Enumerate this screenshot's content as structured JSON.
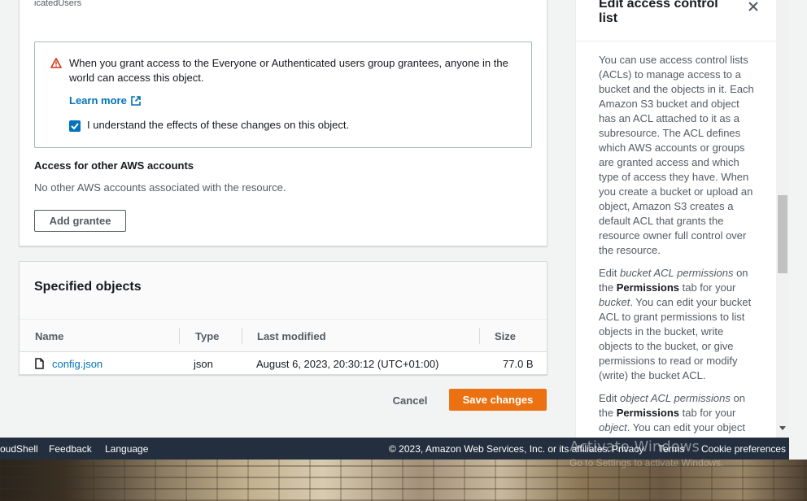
{
  "main": {
    "clipped_text": "icatedUsers",
    "warning": {
      "text": "When you grant access to the Everyone or Authenticated users group grantees, anyone in the world can access this object.",
      "learn_more": "Learn more",
      "checkbox_label": "I understand the effects of these changes on this object.",
      "checkbox_checked": true
    },
    "other_accounts": {
      "heading": "Access for other AWS accounts",
      "description": "No other AWS accounts associated with the resource.",
      "add_grantee": "Add grantee"
    },
    "specified_objects": {
      "title": "Specified objects",
      "columns": [
        "Name",
        "Type",
        "Last modified",
        "Size"
      ],
      "rows": [
        {
          "name": "config.json",
          "type": "json",
          "last_modified": "August 6, 2023, 20:30:12 (UTC+01:00)",
          "size": "77.0 B"
        }
      ]
    },
    "actions": {
      "cancel": "Cancel",
      "save": "Save changes"
    }
  },
  "help_panel": {
    "title": "Edit access control list",
    "p1": "You can use access control lists (ACLs) to manage access to a bucket and the objects in it. Each Amazon S3 bucket and object has an ACL attached to it as a subresource. The ACL defines which AWS accounts or groups are granted access and which type of access they have. When you create a bucket or upload an object, Amazon S3 creates a default ACL that grants the resource owner full control over the resource.",
    "p2_a": "Edit ",
    "p2_em": "bucket ACL permissions",
    "p2_b": " on the ",
    "p2_strong": "Permissions",
    "p2_c": " tab for your ",
    "p2_em2": "bucket",
    "p2_d": ". You can edit your bucket ACL to grant permissions to list objects in the bucket, write objects to the bucket, or give permissions to read or modify (write) the bucket ACL.",
    "p3_a": "Edit ",
    "p3_em": "object ACL permissions",
    "p3_b": " on the ",
    "p3_strong": "Permissions",
    "p3_c": " tab for your ",
    "p3_em2": "object",
    "p3_d": ". You can edit your object ACL to grant..."
  },
  "footer": {
    "cloudshell": "oudShell",
    "feedback": "Feedback",
    "language": "Language",
    "copyright": "© 2023, Amazon Web Services, Inc. or its affiliates.",
    "privacy": "Privacy",
    "terms": "Terms",
    "cookie": "Cookie preferences"
  },
  "os": {
    "watermark": "Activate Windows",
    "watermark_sub": "Go to Settings to activate Windows."
  },
  "colors": {
    "primary": "#ec7211",
    "link": "#0073bb",
    "footer_bg": "#232f3e",
    "warning": "#d13212"
  }
}
